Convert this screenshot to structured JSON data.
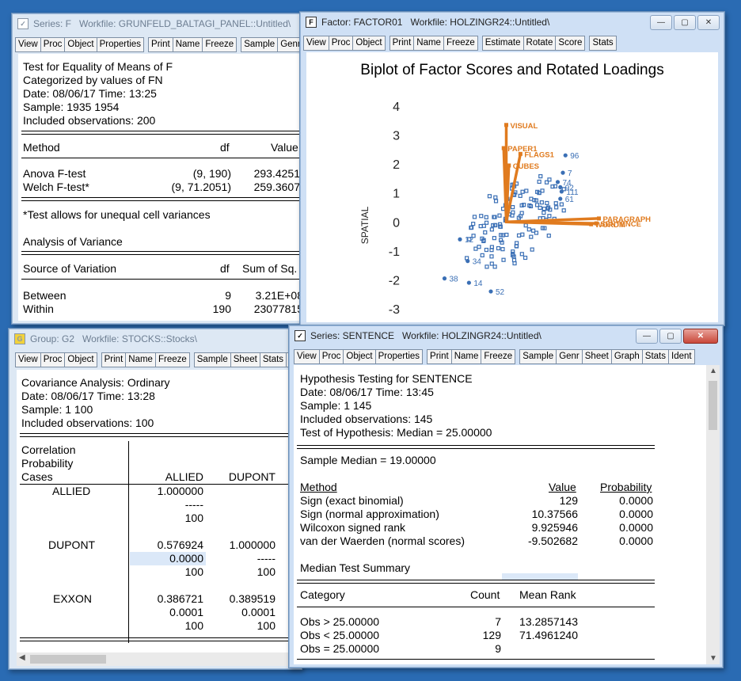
{
  "win_f": {
    "title": "Series: F",
    "workfile": "Workfile: GRUNFELD_BALTAGI_PANEL::Untitled\\",
    "toolbar": [
      "View",
      "Proc",
      "Object",
      "Properties",
      "Print",
      "Name",
      "Freeze",
      "Sample",
      "Genr"
    ],
    "header": [
      "Test for Equality of Means of F",
      "Categorized by values of FN",
      "Date: 08/06/17   Time: 13:25",
      "Sample: 1935 1954",
      "Included observations: 200"
    ],
    "col_method": "Method",
    "col_df": "df",
    "col_value": "Value",
    "rows": [
      {
        "label": "Anova F-test",
        "df": "(9, 190)",
        "value": "293.4251"
      },
      {
        "label": "Welch F-test*",
        "df": "(9, 71.2051)",
        "value": "259.3607"
      }
    ],
    "note": "*Test allows for unequal cell variances",
    "anova_title": "Analysis of Variance",
    "col_source": "Source of Variation",
    "col_df2": "df",
    "col_ss": "Sum of Sq.",
    "rows2": [
      {
        "label": "Between",
        "df": "9",
        "value": "3.21E+08"
      },
      {
        "label": "Within",
        "df": "190",
        "value": "23077815"
      }
    ]
  },
  "win_factor": {
    "title": "Factor: FACTOR01",
    "workfile": "Workfile: HOLZINGR24::Untitled\\",
    "toolbar": [
      "View",
      "Proc",
      "Object",
      "Print",
      "Name",
      "Freeze",
      "Estimate",
      "Rotate",
      "Score",
      "Stats"
    ]
  },
  "chart_data": {
    "type": "scatter",
    "title": "Biplot of Factor Scores and Rotated Loadings",
    "ylabel": "SPATIAL",
    "xlabel": "",
    "ylim": [
      -3,
      4
    ],
    "xlim": [
      -3,
      5
    ],
    "yticks": [
      "4",
      "3",
      "2",
      "1",
      "0",
      "-1",
      "-2",
      "-3"
    ],
    "loadings": [
      {
        "name": "VISUAL",
        "x": 0.0,
        "y": 3.35
      },
      {
        "name": "PAPER1",
        "x": -0.1,
        "y": 2.55
      },
      {
        "name": "FLAGS1",
        "x": 0.55,
        "y": 2.35
      },
      {
        "name": "CUBES",
        "x": 0.1,
        "y": 1.95
      },
      {
        "name": "PARAGRAPH",
        "x": 3.6,
        "y": 0.12
      },
      {
        "name": "SENTENCE",
        "x": 3.5,
        "y": -0.05
      },
      {
        "name": "WORDM",
        "x": 3.3,
        "y": -0.08
      }
    ],
    "labeled_scores": [
      {
        "name": "96",
        "x": 2.3,
        "y": 2.3
      },
      {
        "name": "7",
        "x": 2.2,
        "y": 1.7
      },
      {
        "name": "74",
        "x": 2.0,
        "y": 1.38
      },
      {
        "name": "92",
        "x": 2.1,
        "y": 1.2
      },
      {
        "name": "111",
        "x": 2.15,
        "y": 1.05
      },
      {
        "name": "61",
        "x": 2.1,
        "y": 0.8
      },
      {
        "name": "12",
        "x": -1.8,
        "y": -0.6
      },
      {
        "name": "34",
        "x": -1.5,
        "y": -1.35
      },
      {
        "name": "38",
        "x": -2.4,
        "y": -1.95
      },
      {
        "name": "14",
        "x": -1.45,
        "y": -2.1
      },
      {
        "name": "52",
        "x": -0.6,
        "y": -2.4
      }
    ]
  },
  "win_group": {
    "title": "Group: G2",
    "workfile": "Workfile: STOCKS::Stocks\\",
    "toolbar": [
      "View",
      "Proc",
      "Object",
      "Print",
      "Name",
      "Freeze",
      "Sample",
      "Sheet",
      "Stats",
      "S"
    ],
    "header": [
      "Covariance Analysis: Ordinary",
      "Date: 08/06/17   Time: 13:28",
      "Sample: 1 100",
      "Included observations: 100"
    ],
    "corner": [
      "Correlation",
      "Probability",
      "Cases"
    ],
    "cols": [
      "ALLIED",
      "DUPONT"
    ],
    "rows": [
      {
        "label": "ALLIED",
        "cells": [
          [
            "1.000000",
            "-----",
            "100"
          ],
          [
            "",
            "",
            ""
          ]
        ]
      },
      {
        "label": "DUPONT",
        "cells": [
          [
            "0.576924",
            "0.0000",
            "100"
          ],
          [
            "1.000000",
            "-----",
            "100"
          ]
        ]
      },
      {
        "label": "EXXON",
        "cells": [
          [
            "0.386721",
            "0.0001",
            "100"
          ],
          [
            "0.389519",
            "0.0001",
            "100"
          ]
        ]
      }
    ]
  },
  "win_sentence": {
    "title": "Series: SENTENCE",
    "workfile": "Workfile: HOLZINGR24::Untitled\\",
    "toolbar": [
      "View",
      "Proc",
      "Object",
      "Properties",
      "Print",
      "Name",
      "Freeze",
      "Sample",
      "Genr",
      "Sheet",
      "Graph",
      "Stats",
      "Ident"
    ],
    "header": [
      "Hypothesis Testing for SENTENCE",
      "Date: 08/06/17   Time: 13:45",
      "Sample: 1 145",
      "Included observations: 145",
      "Test of Hypothesis:  Median =  25.00000"
    ],
    "sample_median": "Sample Median =  19.00000",
    "col_method": "Method",
    "col_value": "Value",
    "col_prob": "Probability",
    "rows": [
      {
        "label": "Sign (exact binomial)",
        "value": "129",
        "prob": "0.0000"
      },
      {
        "label": "Sign (normal approximation)",
        "value": "10.37566",
        "prob": "0.0000"
      },
      {
        "label": "Wilcoxon signed rank",
        "value": "9.925946",
        "prob": "0.0000"
      },
      {
        "label": "van der Waerden (normal scores)",
        "value": "-9.502682",
        "prob": "0.0000"
      }
    ],
    "summary_title": "Median Test Summary",
    "col_cat": "Category",
    "col_count": "Count",
    "col_rank": "Mean Rank",
    "rows2": [
      {
        "label": "Obs >  25.00000",
        "count": "7",
        "rank": "13.2857143"
      },
      {
        "label": "Obs <  25.00000",
        "count": "129",
        "rank": "71.4961240"
      },
      {
        "label": "Obs =  25.00000",
        "count": "9",
        "rank": ""
      }
    ]
  },
  "colors": {
    "desktop": "#2a6bb3",
    "score": "#3a6fb5",
    "loading": "#e07b1f"
  }
}
